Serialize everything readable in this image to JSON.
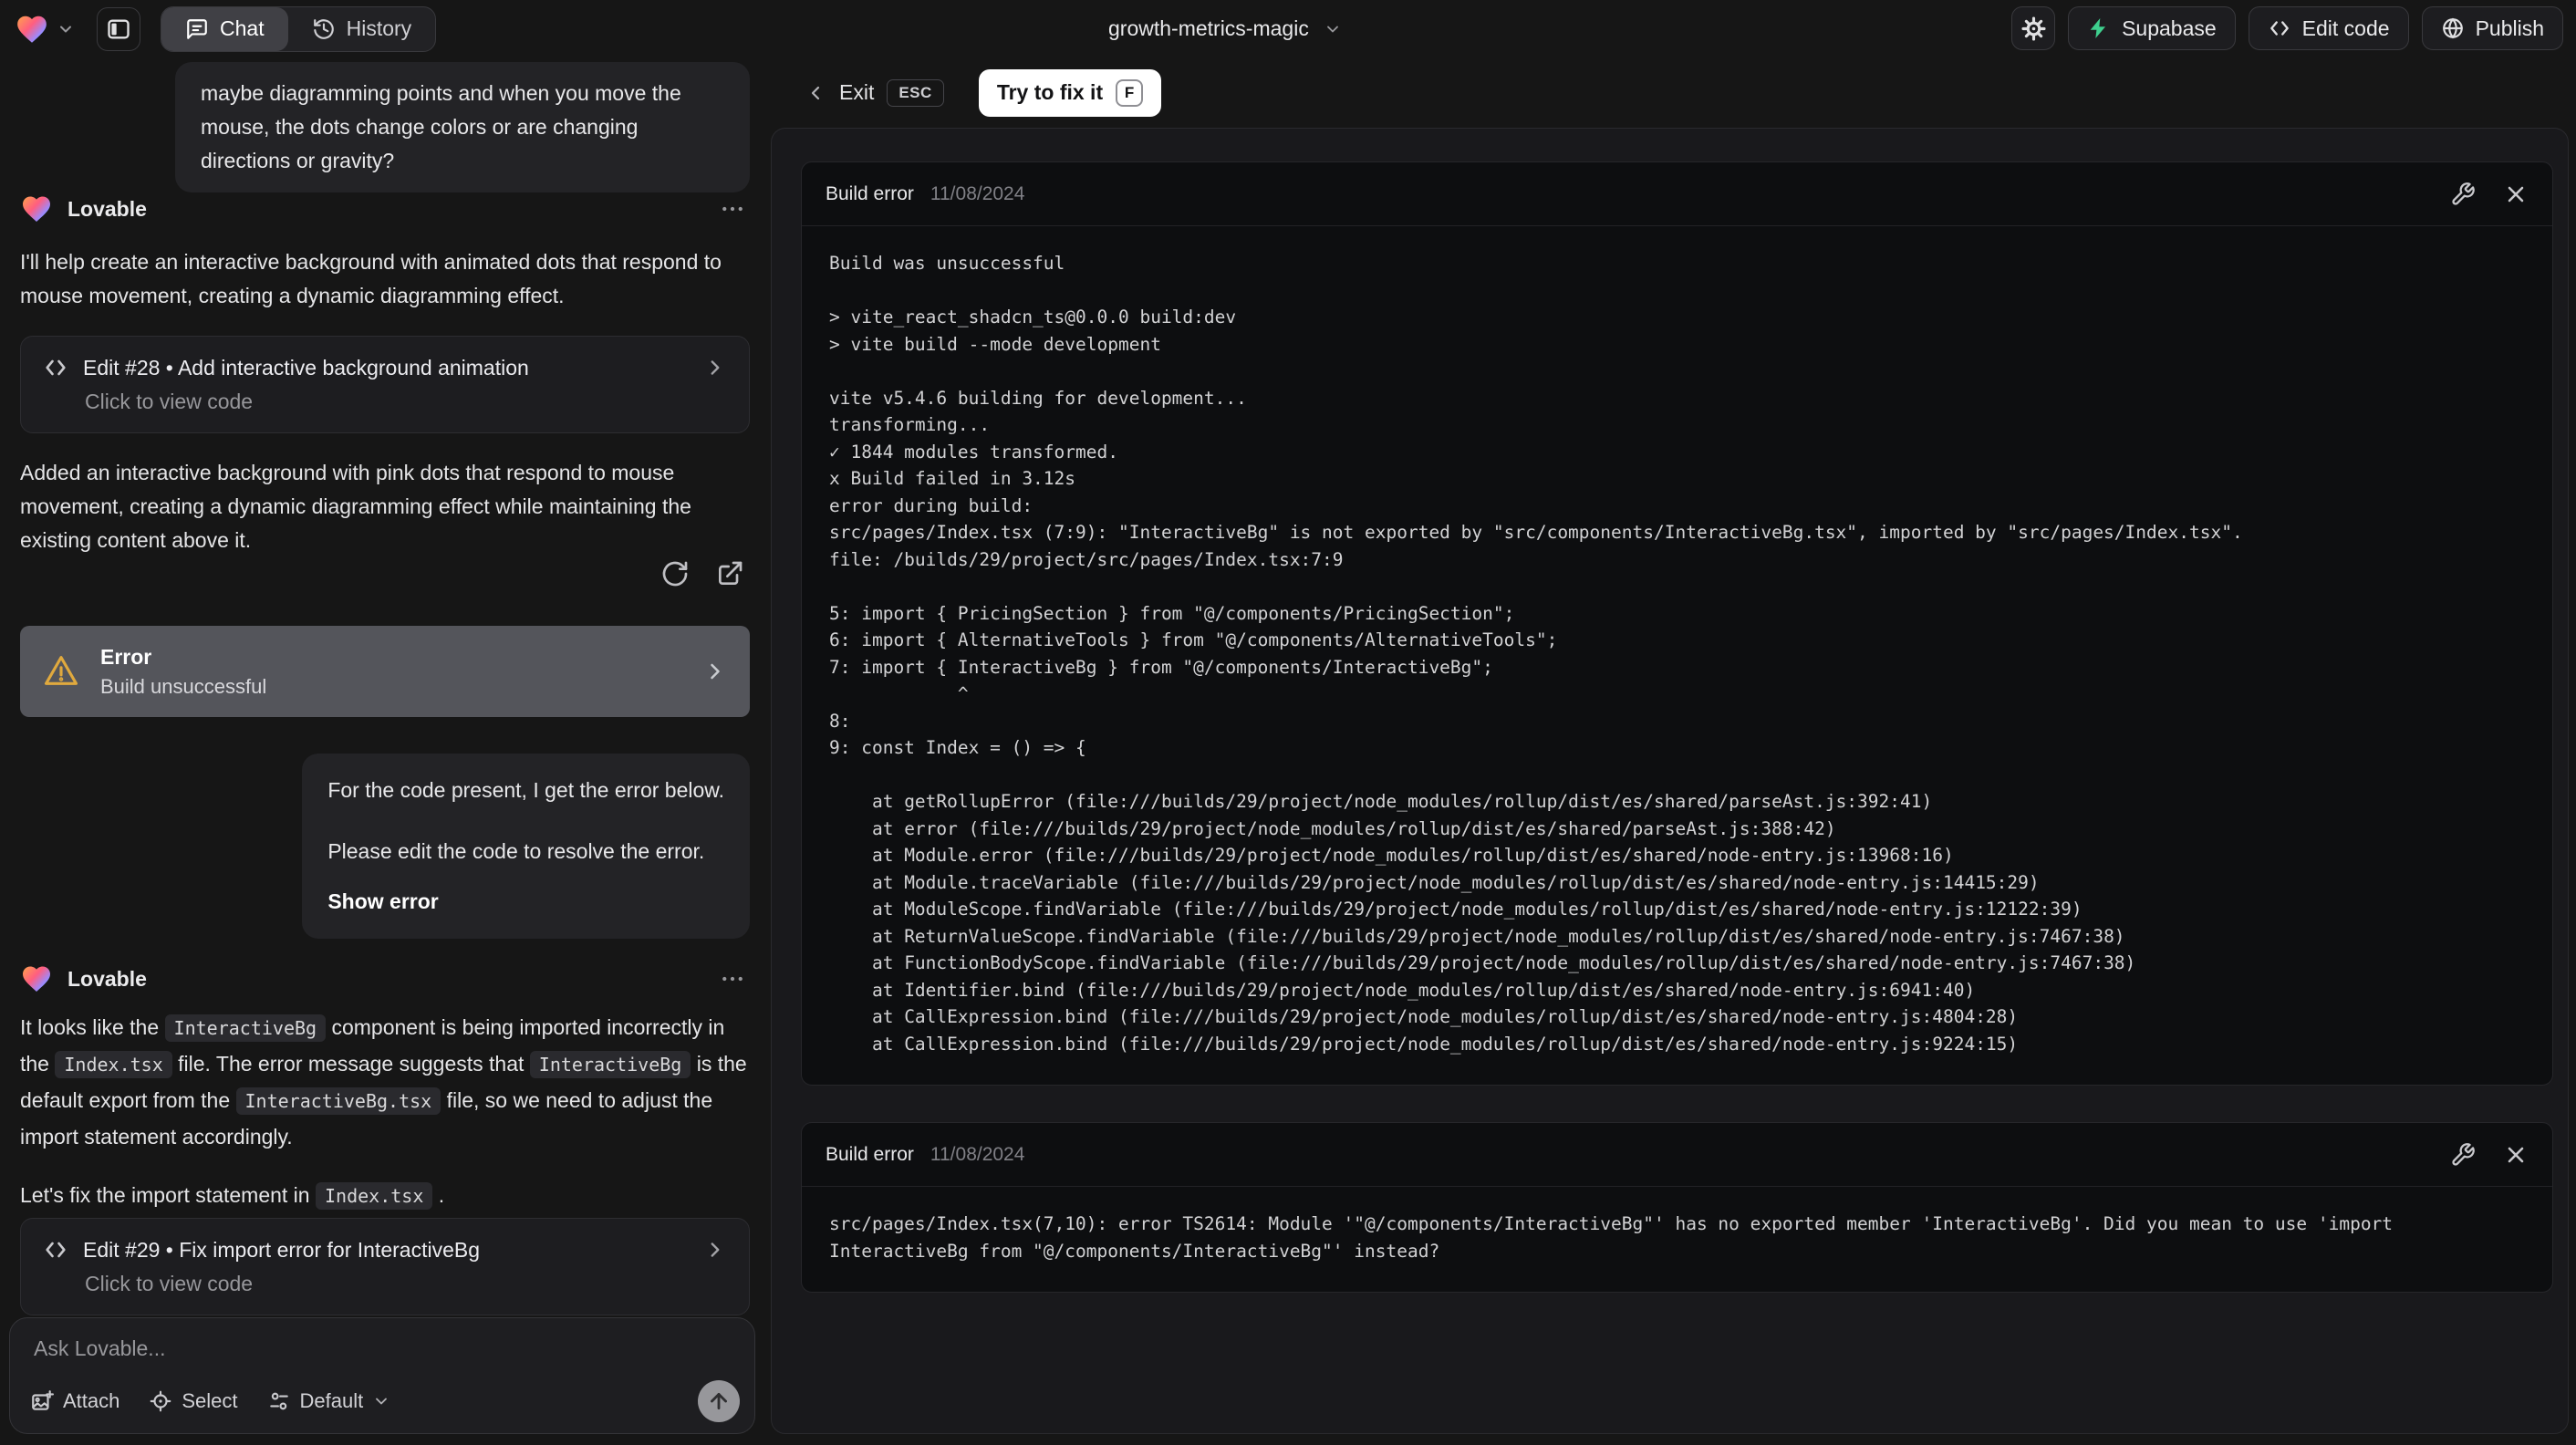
{
  "topbar": {
    "tab_chat": "Chat",
    "tab_history": "History",
    "project_title": "growth-metrics-magic",
    "btn_supabase": "Supabase",
    "btn_edit_code": "Edit code",
    "btn_publish": "Publish"
  },
  "chat": {
    "assistant_name": "Lovable",
    "user_prompt": "maybe diagramming points and when you move the mouse, the dots change colors or are changing directions or gravity?",
    "intro": "I'll help create an interactive background with animated dots that respond to mouse movement, creating a dynamic diagramming effect.",
    "edit28": {
      "title": "Edit #28 • Add interactive background animation",
      "subtitle": "Click to view code"
    },
    "summary": "Added an interactive background with pink dots that respond to mouse movement, creating a dynamic diagramming effect while maintaining the existing content above it.",
    "error_banner": {
      "title": "Error",
      "subtitle": "Build unsuccessful"
    },
    "error_request": {
      "line1": "For the code present, I get the error below.",
      "line2": "Please edit the code to resolve the error.",
      "action": "Show error"
    },
    "fix_message": {
      "p1": [
        "It looks like the ",
        "InteractiveBg",
        " component is being imported incorrectly in the ",
        "Index.tsx",
        " file. The error message suggests that ",
        "InteractiveBg",
        " is the default export from the ",
        "InteractiveBg.tsx",
        " file, so we need to adjust the import statement accordingly."
      ],
      "p2": [
        "Let's fix the import statement in ",
        "Index.tsx",
        " ."
      ]
    },
    "edit29": {
      "title": "Edit #29 • Fix import error for InteractiveBg",
      "subtitle": "Click to view code"
    },
    "input": {
      "placeholder": "Ask Lovable...",
      "attach": "Attach",
      "select": "Select",
      "mode": "Default"
    }
  },
  "preview": {
    "exit_label": "Exit",
    "esc_key": "ESC",
    "fix_button": "Try to fix it",
    "fix_key": "F",
    "panels": [
      {
        "title": "Build error",
        "date": "11/08/2024",
        "log": "Build was unsuccessful\n\n> vite_react_shadcn_ts@0.0.0 build:dev\n> vite build --mode development\n\nvite v5.4.6 building for development...\ntransforming...\n✓ 1844 modules transformed.\nx Build failed in 3.12s\nerror during build:\nsrc/pages/Index.tsx (7:9): \"InteractiveBg\" is not exported by \"src/components/InteractiveBg.tsx\", imported by \"src/pages/Index.tsx\".\nfile: /builds/29/project/src/pages/Index.tsx:7:9\n\n5: import { PricingSection } from \"@/components/PricingSection\";\n6: import { AlternativeTools } from \"@/components/AlternativeTools\";\n7: import { InteractiveBg } from \"@/components/InteractiveBg\";\n            ^\n8: \n9: const Index = () => {\n\n    at getRollupError (file:///builds/29/project/node_modules/rollup/dist/es/shared/parseAst.js:392:41)\n    at error (file:///builds/29/project/node_modules/rollup/dist/es/shared/parseAst.js:388:42)\n    at Module.error (file:///builds/29/project/node_modules/rollup/dist/es/shared/node-entry.js:13968:16)\n    at Module.traceVariable (file:///builds/29/project/node_modules/rollup/dist/es/shared/node-entry.js:14415:29)\n    at ModuleScope.findVariable (file:///builds/29/project/node_modules/rollup/dist/es/shared/node-entry.js:12122:39)\n    at ReturnValueScope.findVariable (file:///builds/29/project/node_modules/rollup/dist/es/shared/node-entry.js:7467:38)\n    at FunctionBodyScope.findVariable (file:///builds/29/project/node_modules/rollup/dist/es/shared/node-entry.js:7467:38)\n    at Identifier.bind (file:///builds/29/project/node_modules/rollup/dist/es/shared/node-entry.js:6941:40)\n    at CallExpression.bind (file:///builds/29/project/node_modules/rollup/dist/es/shared/node-entry.js:4804:28)\n    at CallExpression.bind (file:///builds/29/project/node_modules/rollup/dist/es/shared/node-entry.js:9224:15)"
      },
      {
        "title": "Build error",
        "date": "11/08/2024",
        "log": "src/pages/Index.tsx(7,10): error TS2614: Module '\"@/components/InteractiveBg\"' has no exported member 'InteractiveBg'. Did you mean to use 'import\nInteractiveBg from \"@/components/InteractiveBg\"' instead?"
      }
    ]
  },
  "colors": {
    "accent_green": "#3ecf8e",
    "warning_yellow": "#e0a93e",
    "error_banner_bg": "#54555b"
  }
}
